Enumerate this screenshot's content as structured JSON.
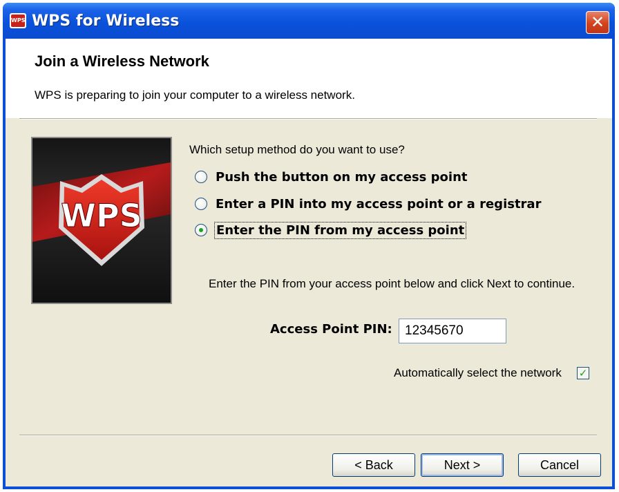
{
  "window": {
    "title": "WPS for Wireless",
    "close_symbol": "✕"
  },
  "header": {
    "heading": "Join a Wireless Network",
    "subheading": "WPS is preparing to join your computer to a wireless network."
  },
  "image": {
    "logo_text": "WPS"
  },
  "setup": {
    "question": "Which setup method do you want to use?",
    "options": [
      {
        "label": "Push the button on my access point",
        "checked": false
      },
      {
        "label": "Enter a PIN into my access point or a registrar",
        "checked": false
      },
      {
        "label": "Enter the PIN from my access point",
        "checked": true
      }
    ],
    "info": "Enter the PIN from your access point below and click Next to continue.",
    "pin_label": "Access Point PIN:",
    "pin_value": "12345670",
    "auto_select_label": "Automatically select the network",
    "auto_select_checked": true
  },
  "buttons": {
    "back": "< Back",
    "next": "Next >",
    "cancel": "Cancel"
  }
}
